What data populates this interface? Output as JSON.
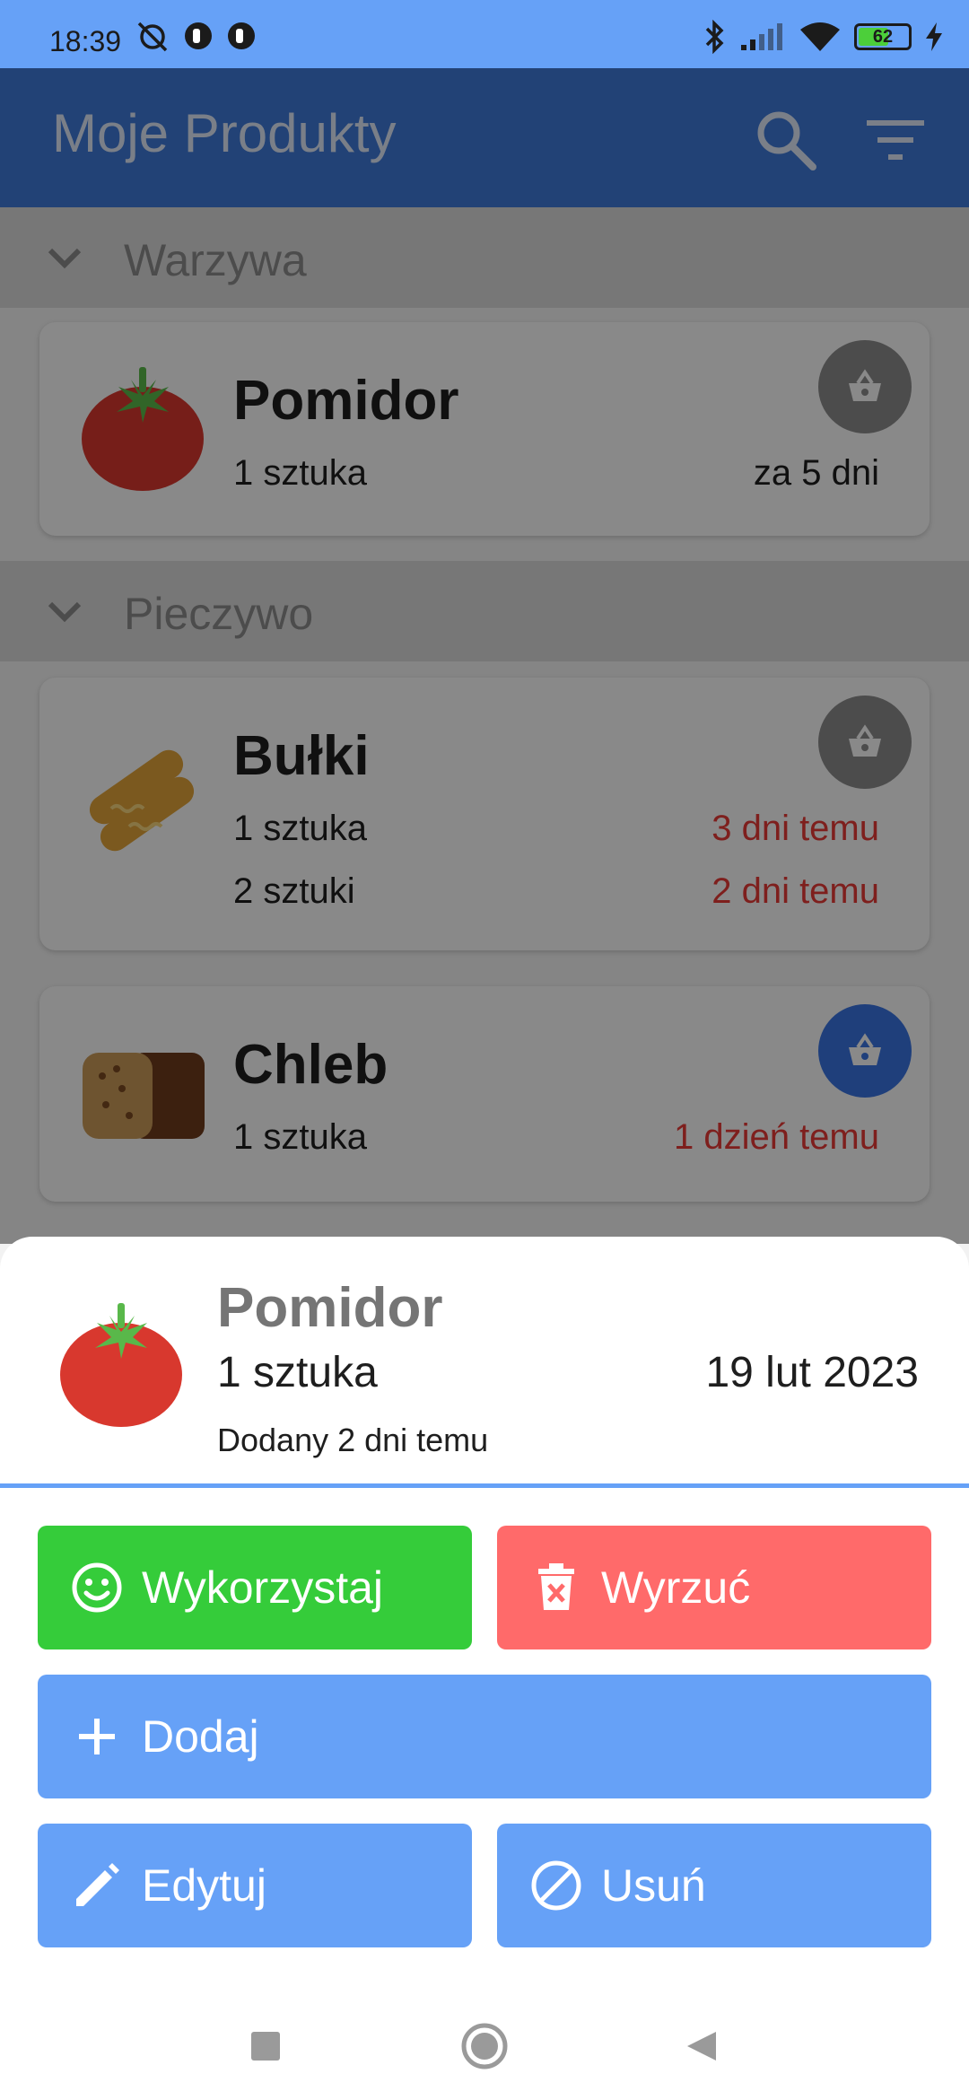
{
  "status_bar": {
    "time": "18:39",
    "battery": "62",
    "battery_level": 0.62
  },
  "app_bar": {
    "title": "Moje Produkty"
  },
  "sections": [
    {
      "label": "Warzywa"
    },
    {
      "label": "Pieczywo"
    }
  ],
  "products": [
    {
      "name": "Pomidor",
      "rows": [
        {
          "qty": "1 sztuka",
          "when": "za 5 dni",
          "overdue": false
        }
      ],
      "basket_active": false
    },
    {
      "name": "Bułki",
      "rows": [
        {
          "qty": "1 sztuka",
          "when": "3 dni temu",
          "overdue": true
        },
        {
          "qty": "2 sztuki",
          "when": "2 dni temu",
          "overdue": true
        }
      ],
      "basket_active": false
    },
    {
      "name": "Chleb",
      "rows": [
        {
          "qty": "1 sztuka",
          "when": "1 dzień temu",
          "overdue": true
        }
      ],
      "basket_active": true
    }
  ],
  "sheet": {
    "name": "Pomidor",
    "qty": "1 sztuka",
    "date": "19 lut 2023",
    "added": "Dodany 2 dni temu",
    "buttons": {
      "use": "Wykorzystaj",
      "discard": "Wyrzuć",
      "add": "Dodaj",
      "edit": "Edytuj",
      "delete": "Usuń"
    }
  },
  "colors": {
    "primary": "#3e78d8",
    "accent": "#66a1f7",
    "use": "#35cc3a",
    "discard": "#ff6a6a",
    "overdue": "#e53935"
  }
}
